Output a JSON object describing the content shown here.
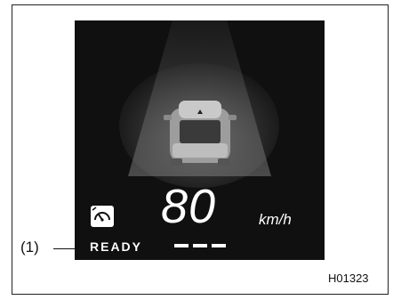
{
  "display": {
    "speed_value": "80",
    "speed_unit": "km/h",
    "status_text": "READY",
    "set_speed_placeholder": [
      "—",
      "—",
      "—"
    ]
  },
  "callouts": {
    "item_1": "(1)"
  },
  "figure_code": "H01323",
  "icons": {
    "cruise": "cruise-control-speedometer-icon",
    "vehicle": "lead-vehicle-icon"
  },
  "colors": {
    "display_background": "#101010",
    "text_on_display": "#ffffff",
    "frame_border": "#222222"
  }
}
